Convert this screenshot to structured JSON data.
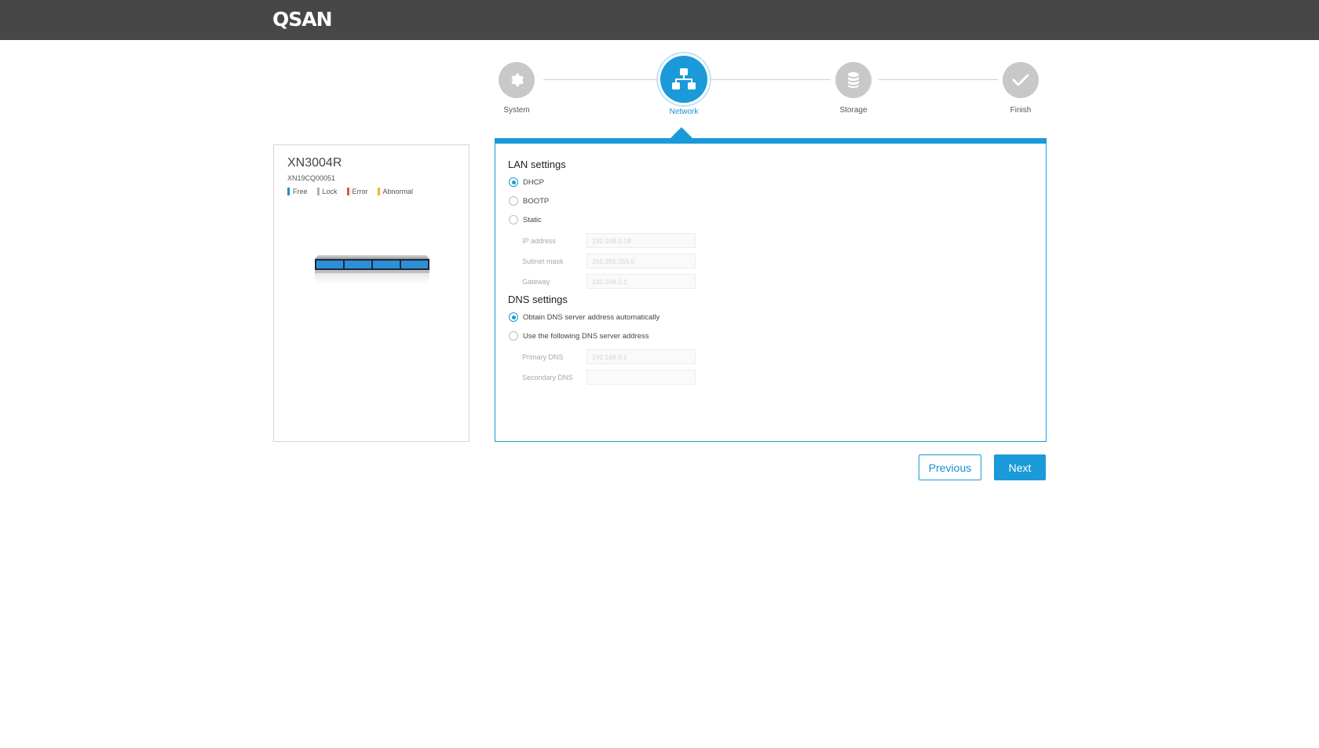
{
  "header": {
    "logo_text": "QSAN"
  },
  "stepper": {
    "steps": [
      {
        "label": "System",
        "icon": "gear-icon",
        "state": "inactive"
      },
      {
        "label": "Network",
        "icon": "network-icon",
        "state": "active"
      },
      {
        "label": "Storage",
        "icon": "database-icon",
        "state": "inactive"
      },
      {
        "label": "Finish",
        "icon": "checkmark-icon",
        "state": "inactive"
      }
    ]
  },
  "device": {
    "model": "XN3004R",
    "serial": "XN19CQ00051",
    "legend": [
      {
        "label": "Free",
        "color": "#1a8fd0"
      },
      {
        "label": "Lock",
        "color": "#b0b0b0"
      },
      {
        "label": "Error",
        "color": "#e0533a"
      },
      {
        "label": "Abnormal",
        "color": "#f0b429"
      }
    ]
  },
  "lan": {
    "title": "LAN settings",
    "options": [
      {
        "label": "DHCP",
        "checked": true
      },
      {
        "label": "BOOTP",
        "checked": false
      },
      {
        "label": "Static",
        "checked": false
      }
    ],
    "fields": [
      {
        "label": "IP address",
        "placeholder": "192.168.0.18"
      },
      {
        "label": "Subnet mask",
        "placeholder": "255.255.255.0"
      },
      {
        "label": "Gateway",
        "placeholder": "192.168.0.1"
      }
    ]
  },
  "dns": {
    "title": "DNS settings",
    "options": [
      {
        "label": "Obtain DNS server address automatically",
        "checked": true
      },
      {
        "label": "Use the following DNS server address",
        "checked": false
      }
    ],
    "fields": [
      {
        "label": "Primary DNS",
        "placeholder": "192.168.0.1"
      },
      {
        "label": "Secondary DNS",
        "placeholder": ""
      }
    ]
  },
  "actions": {
    "previous_label": "Previous",
    "next_label": "Next"
  },
  "colors": {
    "accent": "#1a9ad8",
    "topbar": "#474747"
  }
}
